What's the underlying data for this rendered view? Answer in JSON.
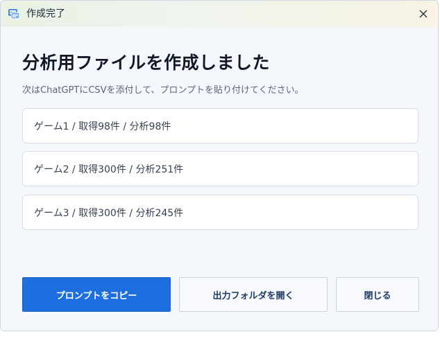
{
  "window": {
    "title": "作成完了",
    "close_glyph": "✕"
  },
  "main": {
    "heading": "分析用ファイルを作成しました",
    "subtitle": "次はChatGPTにCSVを添付して、プロンプトを貼り付けてください。",
    "results": [
      {
        "label": "ゲーム1 / 取得98件 / 分析98件"
      },
      {
        "label": "ゲーム2 / 取得300件 / 分析251件"
      },
      {
        "label": "ゲーム3 / 取得300件 / 分析245件"
      }
    ]
  },
  "actions": {
    "copy_prompt_label": "プロンプトをコピー",
    "open_folder_label": "出力フォルダを開く",
    "close_label": "閉じる"
  },
  "colors": {
    "primary": "#1d6fe0",
    "heading": "#111827",
    "background": "#f4f7fc"
  },
  "icons": {
    "app": "message-window-icon",
    "close": "close-icon"
  }
}
